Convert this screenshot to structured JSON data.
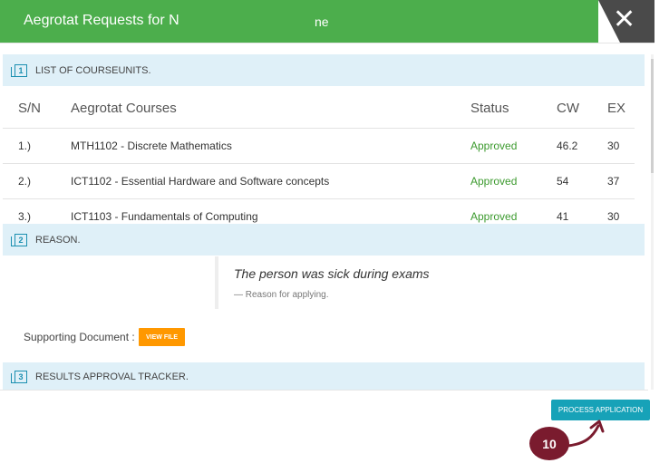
{
  "modal": {
    "title_part1": "Aegrotat Requests for N",
    "title_part2": "ne",
    "close_glyph": "✕"
  },
  "sections": {
    "courses": {
      "number": "1",
      "label": "LIST OF COURSEUNITS."
    },
    "reason": {
      "number": "2",
      "label": "REASON."
    },
    "tracker": {
      "number": "3",
      "label": "RESULTS APPROVAL TRACKER."
    }
  },
  "table": {
    "headers": [
      "S/N",
      "Aegrotat Courses",
      "Status",
      "CW",
      "EX"
    ],
    "rows": [
      {
        "sn": "1.)",
        "course": "MTH1102 - Discrete Mathematics",
        "status": "Approved",
        "cw": "46.2",
        "ex": "30"
      },
      {
        "sn": "2.)",
        "course": "ICT1102 - Essential Hardware and Software concepts",
        "status": "Approved",
        "cw": "54",
        "ex": "37"
      },
      {
        "sn": "3.)",
        "course": "ICT1103 - Fundamentals of Computing",
        "status": "Approved",
        "cw": "41",
        "ex": "30"
      }
    ]
  },
  "reason": {
    "quote": "The person was sick during exams",
    "cite": "— Reason for applying."
  },
  "supporting": {
    "label": "Supporting Document :",
    "button": "VIEW FILE"
  },
  "actions": {
    "process": "PROCESS APPLICATION"
  },
  "annotation": {
    "badge": "10"
  },
  "colors": {
    "header": "#4cae4c",
    "section_bg": "#dff0f8",
    "approved": "#3c9a2e",
    "view_file": "#ff9800",
    "process": "#17a2b8",
    "badge": "#7a1b2e"
  }
}
